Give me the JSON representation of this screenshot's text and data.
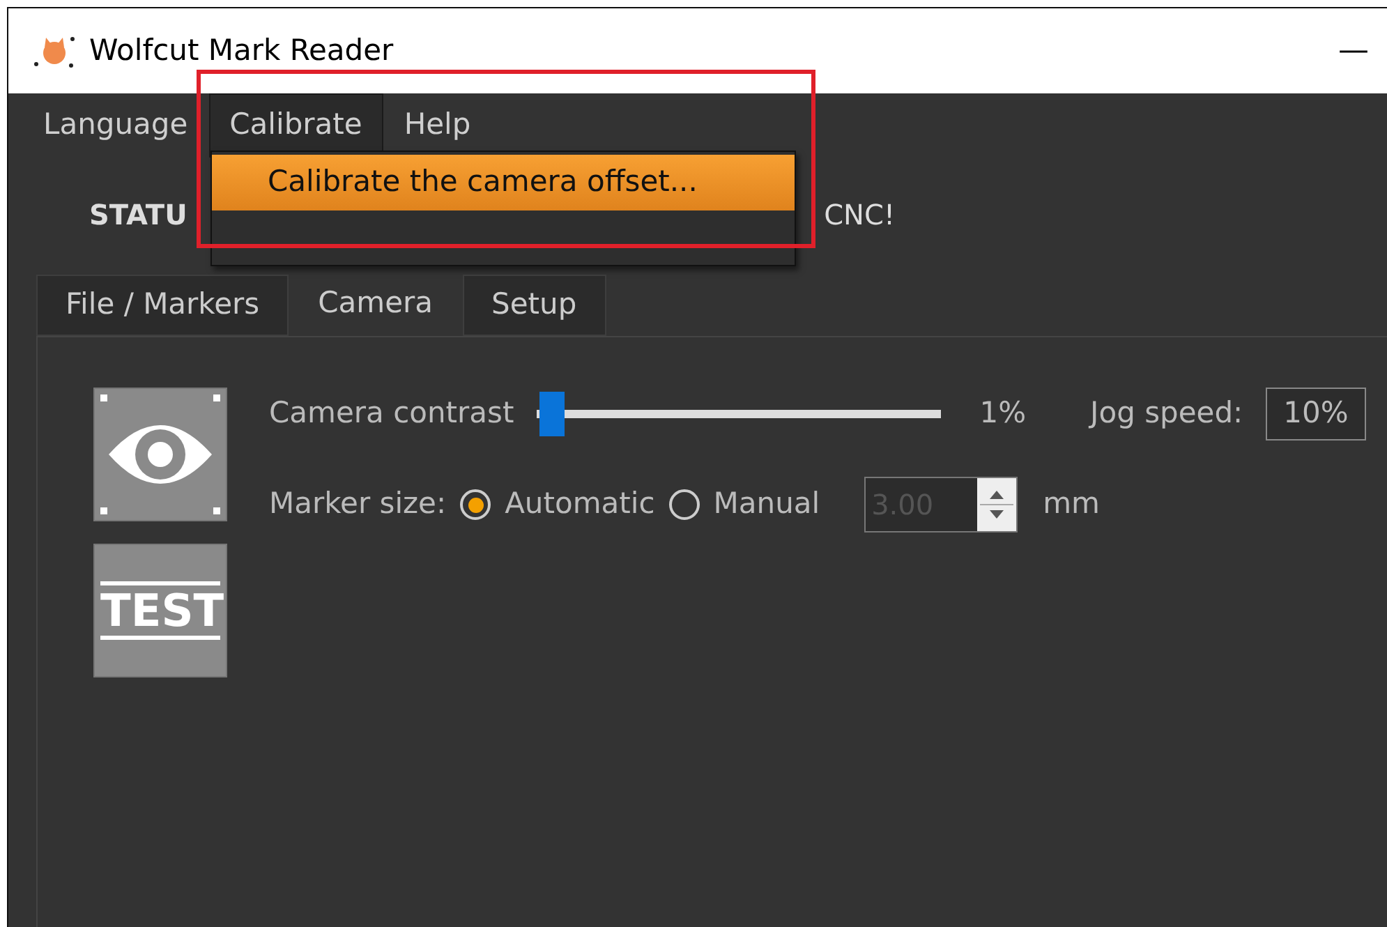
{
  "window": {
    "title": "Wolfcut Mark Reader",
    "minimize": "—"
  },
  "menu": [
    {
      "label": "Language",
      "selected": false
    },
    {
      "label": "Calibrate",
      "selected": true
    },
    {
      "label": "Help",
      "selected": false
    }
  ],
  "dropdown": [
    {
      "label": "Calibrate the camera offset...",
      "selected": true
    }
  ],
  "status": {
    "label": "STATU",
    "message": "CNC!"
  },
  "tabs": [
    {
      "label": "File / Markers",
      "selected": false
    },
    {
      "label": "Camera",
      "selected": true
    },
    {
      "label": "Setup",
      "selected": false
    }
  ],
  "camera": {
    "test_button": "TEST",
    "contrast_label": "Camera contrast",
    "contrast": {
      "level": 0.01
    },
    "contrast_reading": "1%",
    "jog_label": "Jog speed:",
    "jog_value": "10%",
    "marker_label": "Marker size:",
    "options": [
      {
        "label": "Automatic",
        "selected": true
      },
      {
        "label": "Manual",
        "selected": false
      }
    ],
    "size_value": "3.00",
    "size_disabled": true,
    "unit": "mm"
  }
}
